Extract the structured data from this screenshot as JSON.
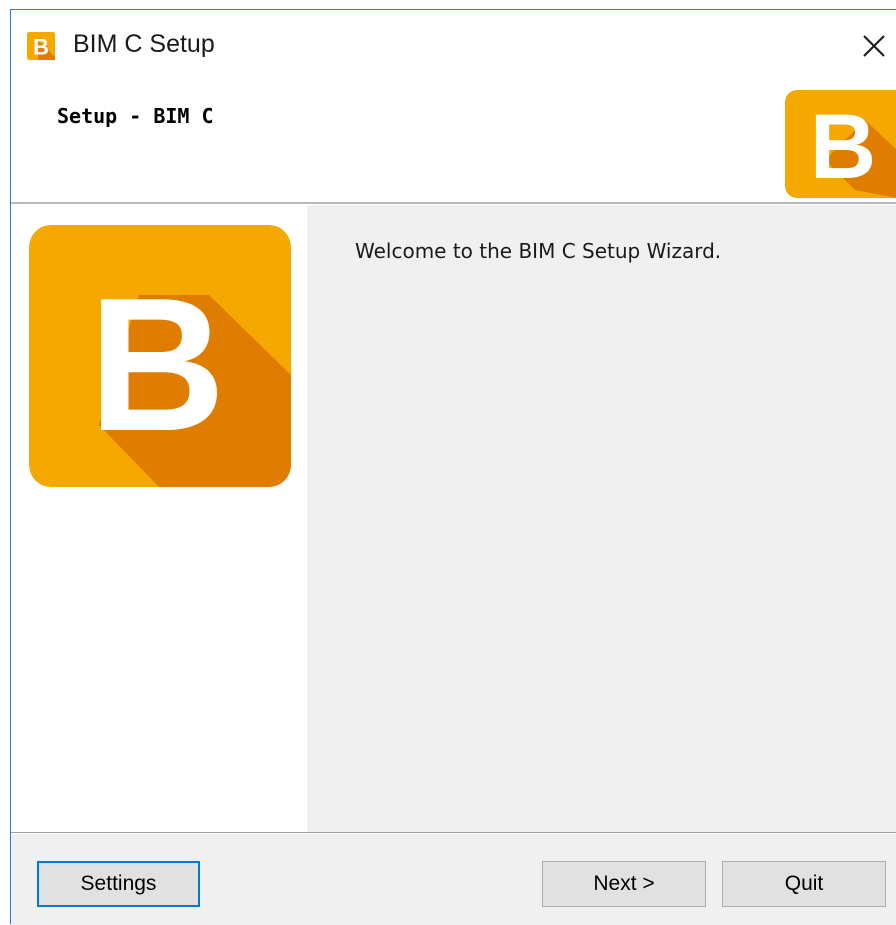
{
  "window": {
    "title": "BIM C Setup"
  },
  "header": {
    "title": "Setup - BIM C"
  },
  "main": {
    "welcome": "Welcome to the BIM C Setup Wizard."
  },
  "footer": {
    "settings_label": "Settings",
    "next_label": "Next >",
    "quit_label": "Quit"
  },
  "icons": {
    "app": "bim-c-logo-icon",
    "close": "close-icon"
  },
  "colors": {
    "logo_orange": "#f5a800",
    "logo_shadow": "#e07c00",
    "logo_letter": "#ffffff",
    "accent": "#0078d7"
  }
}
